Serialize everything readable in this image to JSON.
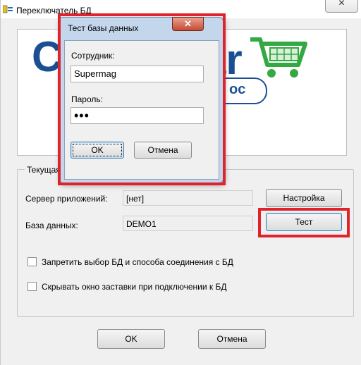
{
  "main": {
    "title": "Переключатель БД",
    "close_glyph": "✕",
    "logo": {
      "left_text": "С",
      "right_text": "ar",
      "pill_text": "oc",
      "cart_icon": "shopping-cart-icon",
      "brand_color": "#1b4f93",
      "cart_color": "#34a843"
    },
    "group_title": "Текущая база данных",
    "server_label": "Сервер приложений:",
    "server_value": "[нет]",
    "settings_button": "Настройка",
    "db_label": "База данных:",
    "db_value": "DEMO1",
    "test_button": "Тест",
    "checkbox1_label": "Запретить выбор БД и способа соединения с БД",
    "checkbox2_label": "Скрывать окно заставки при подключении к БД",
    "ok_button": "OK",
    "cancel_button": "Отмена"
  },
  "dialog": {
    "title": "Тест базы данных",
    "close_glyph": "✕",
    "user_label": "Сотрудник:",
    "user_value": "Supermag",
    "password_label": "Пароль:",
    "password_value": "•••",
    "ok_button": "OK",
    "cancel_button": "Отмена"
  },
  "highlight_color": "#e0222b"
}
